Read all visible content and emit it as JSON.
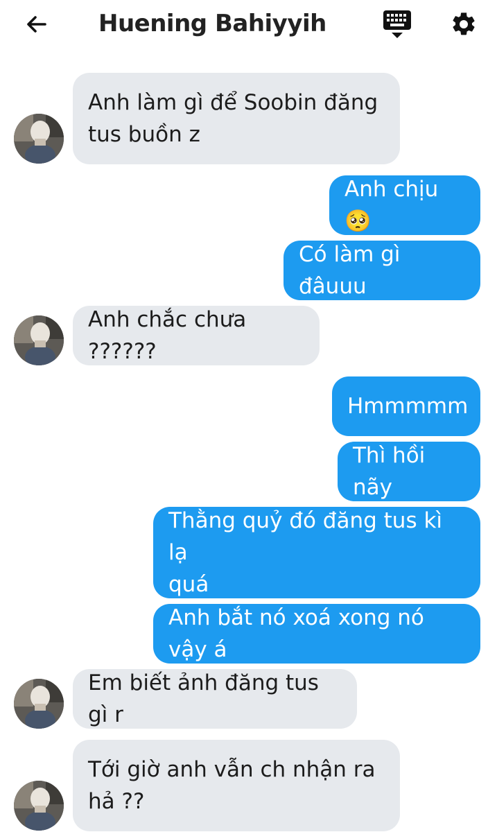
{
  "header": {
    "title": "Huening Bahiyyih",
    "back_icon": "arrow-left-icon",
    "keyboard_icon": "keyboard-icon",
    "settings_icon": "gear-icon"
  },
  "colors": {
    "outgoing_bubble": "#1d9bf0",
    "incoming_bubble": "#e6e9ed",
    "background": "#ffffff"
  },
  "messages": [
    {
      "direction": "incoming",
      "text": "Anh làm gì để Soobin đăng\ntus buồn z"
    },
    {
      "direction": "outgoing",
      "text": "Anh chịu 🥺"
    },
    {
      "direction": "outgoing",
      "text": "Có làm gì đâuuu"
    },
    {
      "direction": "incoming",
      "text": "Anh chắc chưa ??????"
    },
    {
      "direction": "outgoing",
      "text": "Hmmmmm"
    },
    {
      "direction": "outgoing",
      "text": "Thì hồi nãy"
    },
    {
      "direction": "outgoing",
      "text": "Thằng quỷ đó đăng tus kì lạ\nquá"
    },
    {
      "direction": "outgoing",
      "text": "Anh bắt nó xoá xong nó vậy á"
    },
    {
      "direction": "incoming",
      "text": "Em biết ảnh đăng tus gì r"
    },
    {
      "direction": "incoming",
      "text": "Tới giờ anh vẫn ch nhận ra\nhả ??"
    }
  ]
}
